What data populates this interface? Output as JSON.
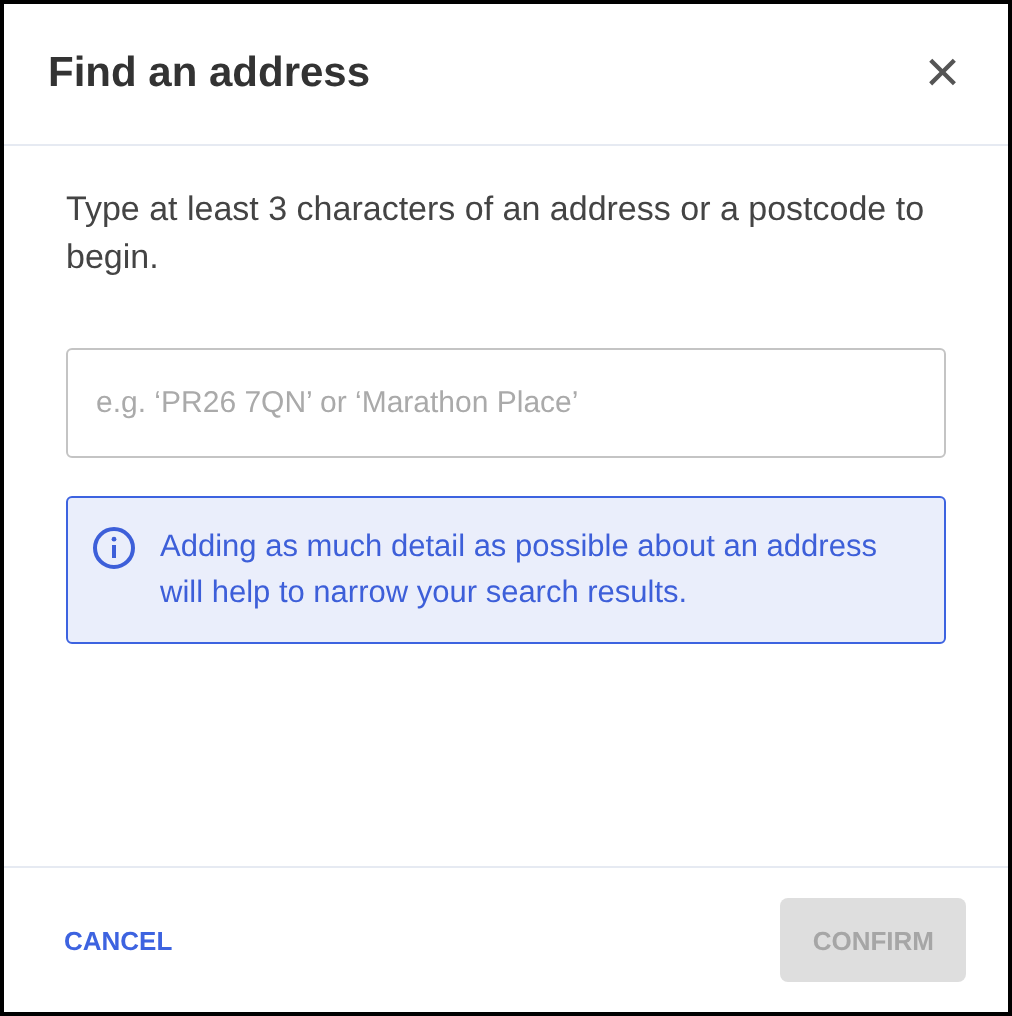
{
  "dialog": {
    "title": "Find an address",
    "close": "×"
  },
  "instructions": "Type at least 3 characters of an address or a postcode to begin.",
  "search": {
    "placeholder": "e.g. ‘PR26 7QN’ or ‘Marathon Place’"
  },
  "info": {
    "text": "Adding as much detail as possible about an address will help to narrow your search results."
  },
  "buttons": [
    {
      "label": "CANCEL",
      "kind": "text",
      "disabled": false
    },
    {
      "label": "CONFIRM",
      "kind": "filled",
      "disabled": true
    }
  ]
}
